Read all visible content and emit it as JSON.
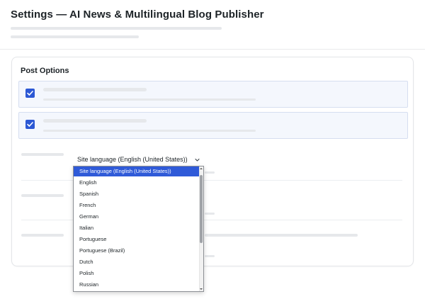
{
  "header": {
    "title": "Settings — AI News & Multilingual Blog Publisher"
  },
  "card": {
    "title": "Post Options"
  },
  "options": [
    {
      "checked": true
    },
    {
      "checked": true
    }
  ],
  "language_select": {
    "value": "Site language (English (United States))",
    "chevron_icon": "chevron-down-icon"
  },
  "language_dropdown": {
    "selected_index": 0,
    "items": [
      "Site language (English (United States))",
      "English",
      "Spanish",
      "French",
      "German",
      "Italian",
      "Portuguese",
      "Portuguese (Brazil)",
      "Dutch",
      "Polish",
      "Russian"
    ]
  },
  "colors": {
    "accent": "#2c58d4",
    "selected_option": "#2f5ad8",
    "row_background": "#f4f7fd",
    "placeholder": "#e6e8eb"
  }
}
